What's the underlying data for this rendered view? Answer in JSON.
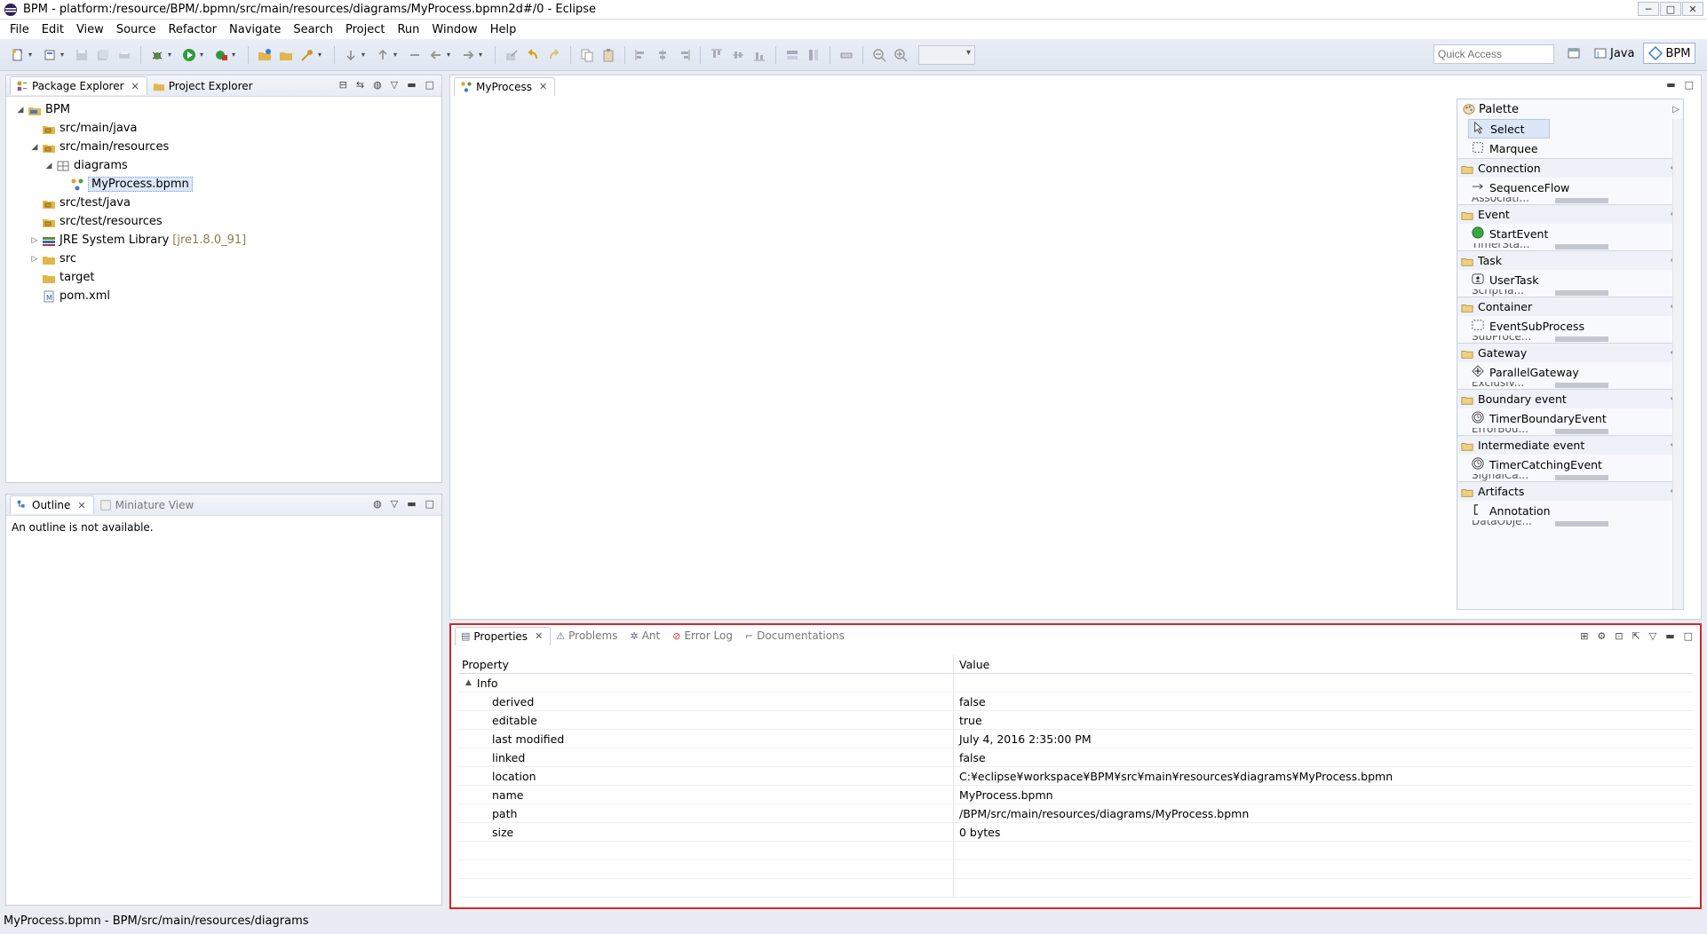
{
  "window": {
    "title": "BPM - platform:/resource/BPM/.bpmn/src/main/resources/diagrams/MyProcess.bpmn2d#/0 - Eclipse",
    "controls": [
      "minimize-icon",
      "maximize-icon",
      "close-icon"
    ]
  },
  "menu": [
    "File",
    "Edit",
    "View",
    "Source",
    "Refactor",
    "Navigate",
    "Search",
    "Project",
    "Run",
    "Window",
    "Help"
  ],
  "toolbar": {
    "quick_access_placeholder": "Quick Access",
    "perspectives": [
      {
        "label": "Java",
        "active": false
      },
      {
        "label": "BPM",
        "active": true
      }
    ]
  },
  "package_explorer": {
    "tabs": [
      {
        "label": "Package Explorer",
        "active": true
      },
      {
        "label": "Project Explorer",
        "active": false
      }
    ],
    "tree": [
      {
        "depth": 0,
        "twisty": "▲",
        "icon": "project-icon",
        "label": "BPM"
      },
      {
        "depth": 1,
        "twisty": "",
        "icon": "source-folder-icon",
        "label": "src/main/java"
      },
      {
        "depth": 1,
        "twisty": "▲",
        "icon": "source-folder-icon",
        "label": "src/main/resources"
      },
      {
        "depth": 2,
        "twisty": "▲",
        "icon": "package-icon",
        "label": "diagrams"
      },
      {
        "depth": 3,
        "twisty": "",
        "icon": "bpmn-file-icon",
        "label": "MyProcess.bpmn",
        "selected": true
      },
      {
        "depth": 1,
        "twisty": "",
        "icon": "source-folder-icon",
        "label": "src/test/java"
      },
      {
        "depth": 1,
        "twisty": "",
        "icon": "source-folder-icon",
        "label": "src/test/resources"
      },
      {
        "depth": 1,
        "twisty": "▷",
        "icon": "library-icon",
        "label": "JRE System Library",
        "decor": "[jre1.8.0_91]"
      },
      {
        "depth": 1,
        "twisty": "▷",
        "icon": "folder-icon",
        "label": "src"
      },
      {
        "depth": 1,
        "twisty": "",
        "icon": "folder-icon",
        "label": "target"
      },
      {
        "depth": 1,
        "twisty": "",
        "icon": "xml-file-icon",
        "label": "pom.xml"
      }
    ]
  },
  "outline": {
    "tabs": [
      {
        "label": "Outline",
        "active": true
      },
      {
        "label": "Miniature View",
        "active": false
      }
    ],
    "message": "An outline is not available."
  },
  "editor": {
    "tab_label": "MyProcess",
    "palette": {
      "title": "Palette",
      "tools": [
        {
          "label": "Select",
          "icon": "arrow-pointer-icon",
          "selected": true
        },
        {
          "label": "Marquee",
          "icon": "marquee-icon",
          "selected": false
        }
      ],
      "drawers": [
        {
          "label": "Connection",
          "first": "SequenceFlow",
          "first_icon": "sequence-flow-icon",
          "cut": "Associati..."
        },
        {
          "label": "Event",
          "first": "StartEvent",
          "first_icon": "start-event-icon",
          "cut": "TimerSta..."
        },
        {
          "label": "Task",
          "first": "UserTask",
          "first_icon": "user-task-icon",
          "cut": "ScriptTa..."
        },
        {
          "label": "Container",
          "first": "EventSubProcess",
          "first_icon": "event-subprocess-icon",
          "cut": "SubProce..."
        },
        {
          "label": "Gateway",
          "first": "ParallelGateway",
          "first_icon": "parallel-gateway-icon",
          "cut": "Exclusiv..."
        },
        {
          "label": "Boundary event",
          "first": "TimerBoundaryEvent",
          "first_icon": "timer-event-icon",
          "cut": "ErrorBou..."
        },
        {
          "label": "Intermediate event",
          "first": "TimerCatchingEvent",
          "first_icon": "timer-event-icon",
          "cut": "SignalCa..."
        },
        {
          "label": "Artifacts",
          "first": "Annotation",
          "first_icon": "annotation-icon",
          "cut": "DataObje..."
        }
      ]
    }
  },
  "properties": {
    "tabs": [
      {
        "label": "Properties",
        "active": true
      },
      {
        "label": "Problems",
        "active": false
      },
      {
        "label": "Ant",
        "active": false
      },
      {
        "label": "Error Log",
        "active": false
      },
      {
        "label": "Documentations",
        "active": false
      }
    ],
    "columns": [
      "Property",
      "Value"
    ],
    "group": "Info",
    "rows": [
      {
        "key": "derived",
        "value": "false"
      },
      {
        "key": "editable",
        "value": "true"
      },
      {
        "key": "last modified",
        "value": "July 4, 2016 2:35:00 PM"
      },
      {
        "key": "linked",
        "value": "false"
      },
      {
        "key": "location",
        "value": "C:¥eclipse¥workspace¥BPM¥src¥main¥resources¥diagrams¥MyProcess.bpmn"
      },
      {
        "key": "name",
        "value": "MyProcess.bpmn"
      },
      {
        "key": "path",
        "value": "/BPM/src/main/resources/diagrams/MyProcess.bpmn"
      },
      {
        "key": "size",
        "value": "0  bytes"
      }
    ]
  },
  "statusbar": {
    "text": "MyProcess.bpmn - BPM/src/main/resources/diagrams"
  }
}
